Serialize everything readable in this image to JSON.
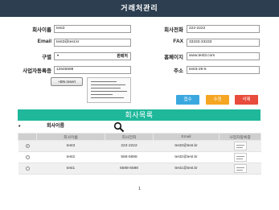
{
  "header": {
    "title": "거래처관리"
  },
  "form": {
    "name_label": "회사이름",
    "name_value": "test3",
    "phone_label": "회사전화",
    "phone_value": "222-2222",
    "email_label": "Email",
    "email_value": "test3@test.kr",
    "fax_label": "FAX",
    "fax_value": "33333-33333",
    "type_label": "구별",
    "type_value": "판매처",
    "homepage_label": "홈페이지",
    "homepage_value": "www.test3.com",
    "bizno_label": "사업자등록증",
    "bizno_value": "12646598",
    "address_label": "주소",
    "address_value": "test3-25-5",
    "bn_button": "+BN Insert"
  },
  "actions": {
    "add": {
      "label": "접수",
      "color": "#3aa8df"
    },
    "edit": {
      "label": "수정",
      "color": "#f5a623"
    },
    "delete": {
      "label": "삭제",
      "color": "#e74c3c"
    }
  },
  "list": {
    "title": "회사목록",
    "search_field": "회사이름",
    "columns": [
      "",
      "회사이름",
      "회사전화",
      "Email",
      "사업자등록증"
    ],
    "rows": [
      {
        "selected": true,
        "name": "test3",
        "phone": "222-2222",
        "email": "test3@test.kr"
      },
      {
        "selected": false,
        "name": "test2",
        "phone": "568-5698",
        "email": "test2@test.kr"
      },
      {
        "selected": false,
        "name": "test1",
        "phone": "6598-6598",
        "email": "test1@test.kr"
      }
    ]
  },
  "pagination": {
    "current": "1"
  },
  "colors": {
    "header_bg": "#2d3e50",
    "list_bar": "#1fb89b"
  }
}
